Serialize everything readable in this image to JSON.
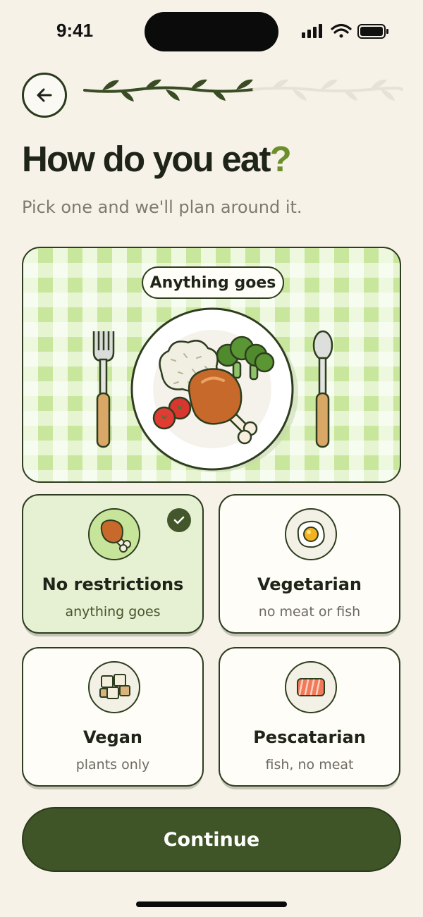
{
  "status_bar": {
    "time": "9:41",
    "icons": [
      "cellular-signal-icon",
      "wifi-icon",
      "battery-icon"
    ]
  },
  "header": {
    "back_icon": "arrow-left-icon",
    "progress": {
      "completed_leaves": 4,
      "total_leaves": 7,
      "fraction": 0.57
    }
  },
  "title": {
    "main": "How do you eat",
    "mark": "?"
  },
  "subtitle": "Pick one and we'll plan around it.",
  "hero": {
    "pill_label": "Anything goes",
    "illustration": "plate-with-chicken-rice-broccoli-tomatoes-icon"
  },
  "options": [
    {
      "label": "No restrictions",
      "sub": "anything goes",
      "icon": "chicken-leg-icon",
      "selected": true
    },
    {
      "label": "Vegetarian",
      "sub": "no meat or fish",
      "icon": "fried-egg-icon",
      "selected": false
    },
    {
      "label": "Vegan",
      "sub": "plants only",
      "icon": "tofu-cubes-icon",
      "selected": false
    },
    {
      "label": "Pescatarian",
      "sub": "fish, no meat",
      "icon": "salmon-fillet-icon",
      "selected": false
    }
  ],
  "continue_label": "Continue",
  "colors": {
    "background": "#f6f2e8",
    "accent": "#3f5427",
    "selected_card": "#e6f0d2",
    "question_mark": "#6c8f2c"
  }
}
